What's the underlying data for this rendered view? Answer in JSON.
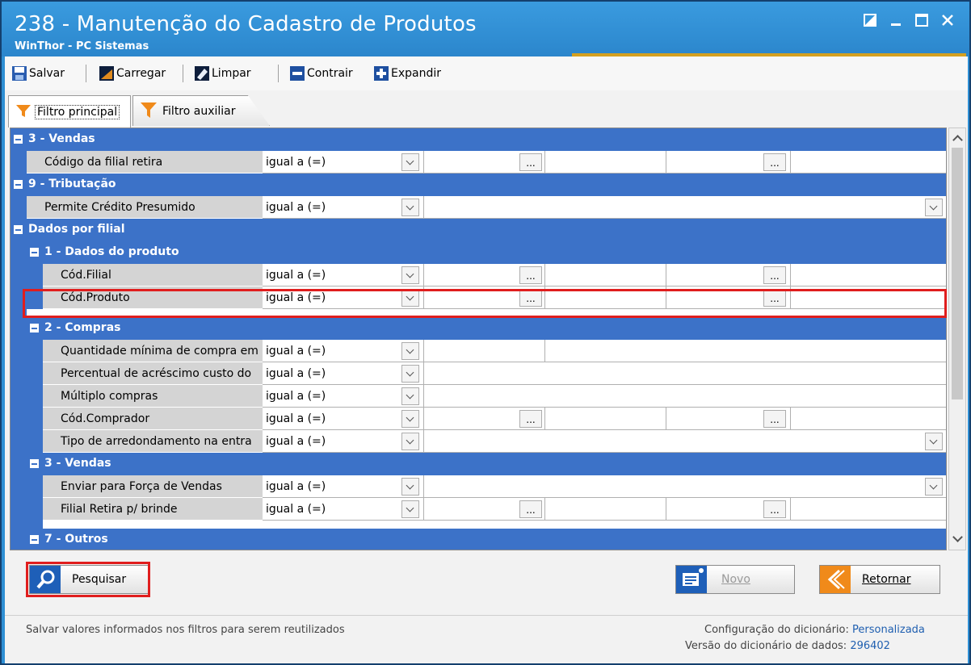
{
  "window": {
    "title": "238 - Manutenção do Cadastro de Produtos",
    "subtitle": "WinThor - PC Sistemas"
  },
  "toolbar": {
    "save_label": "Salvar",
    "load_label": "Carregar",
    "clear_label": "Limpar",
    "collapse_label": "Contrair",
    "expand_label": "Expandir"
  },
  "tabs": {
    "main": "Filtro principal",
    "aux": "Filtro auxiliar"
  },
  "grid": {
    "groups": {
      "vendas_top": "3 - Vendas",
      "tributacao": "9 - Tributação",
      "dados_filial": "Dados por filial",
      "dados_produto": "1 - Dados do produto",
      "compras": "2 - Compras",
      "vendas_filial": "3 - Vendas",
      "outros": "7 - Outros"
    },
    "operator": "igual a (=)",
    "ellipsis": "...",
    "fields": {
      "filial_retira": "Código da filial retira",
      "credito_presumido": "Permite Crédito Presumido",
      "cod_filial": "Cód.Filial",
      "cod_produto": "Cód.Produto",
      "qtd_minima": "Quantidade mínima de compra em",
      "perc_acrescimo": "Percentual de acréscimo custo do",
      "multiplo": "Múltiplo compras",
      "cod_comprador": "Cód.Comprador",
      "tipo_arredondamento": "Tipo de arredondamento na entra",
      "forca_vendas": "Enviar para Força de Vendas",
      "filial_brinde": "Filial Retira p/ brinde"
    }
  },
  "buttons": {
    "search": "Pesquisar",
    "new": "Novo",
    "return": "Retornar"
  },
  "status": {
    "hint": "Salvar valores informados nos filtros para serem reutilizados",
    "dict_config_label": "Configuração do dicionário:",
    "dict_config_value": "Personalizada",
    "dict_version_label": "Versão do dicionário de dados:",
    "dict_version_value": "296402"
  }
}
